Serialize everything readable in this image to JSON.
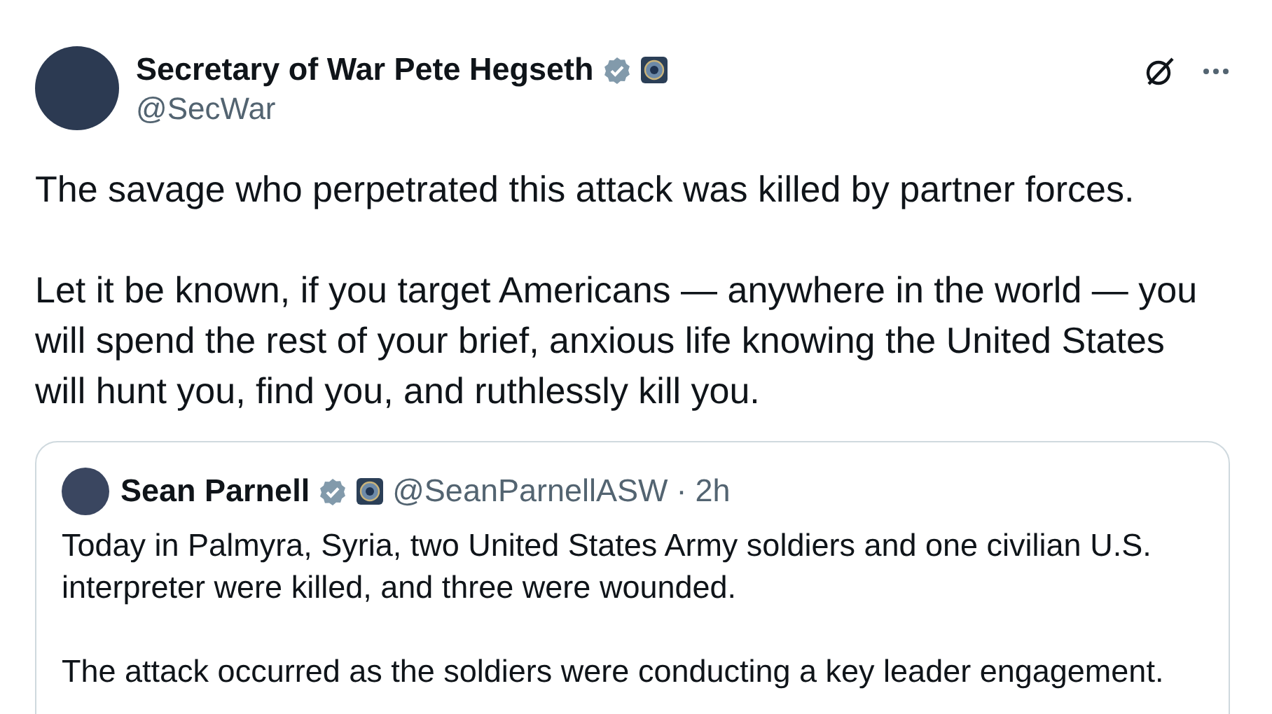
{
  "post": {
    "author": {
      "name": "Secretary of War Pete Hegseth",
      "verified": true,
      "handle": "@SecWar"
    },
    "paragraphs": [
      "The savage who perpetrated this attack was killed by partner forces.",
      "Let it be known, if you target Americans — anywhere in the world — you will spend the rest of your brief, anxious life knowing the United States will hunt you, find you, and ruthlessly kill you."
    ],
    "quote": {
      "author": {
        "name": "Sean Parnell",
        "verified": true,
        "handle": "@SeanParnellASW",
        "separator": "·",
        "time": "2h"
      },
      "paragraphs": [
        "Today in Palmyra, Syria, two United States Army soldiers and one civilian U.S. interpreter were killed, and three were wounded.",
        "The attack occurred as the soldiers were conducting a key leader engagement."
      ]
    }
  }
}
